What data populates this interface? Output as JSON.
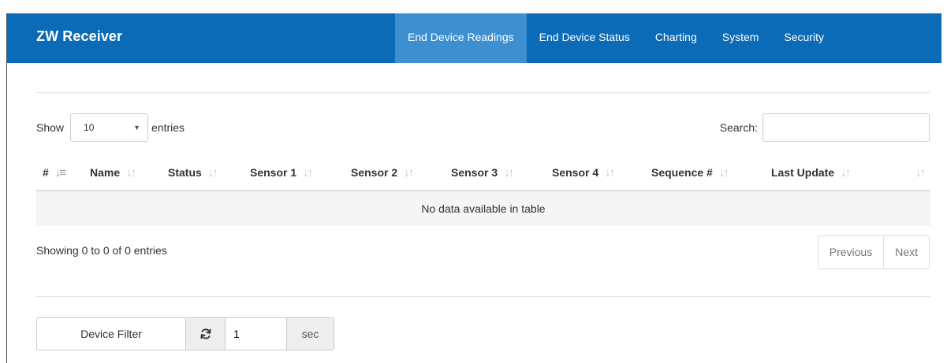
{
  "navbar": {
    "brand": "ZW Receiver",
    "items": [
      {
        "label": "End Device Readings",
        "active": true
      },
      {
        "label": "End Device Status"
      },
      {
        "label": "Charting"
      },
      {
        "label": "System"
      },
      {
        "label": "Security"
      }
    ]
  },
  "length_control": {
    "prefix": "Show",
    "value": "10",
    "suffix": "entries"
  },
  "search": {
    "label": "Search:",
    "value": ""
  },
  "table": {
    "columns": [
      "#",
      "Name",
      "Status",
      "Sensor 1",
      "Sensor 2",
      "Sensor 3",
      "Sensor 4",
      "Sequence #",
      "Last Update",
      ""
    ],
    "sorted_column": "#",
    "empty_message": "No data available in table",
    "rows": []
  },
  "info": "Showing 0 to 0 of 0 entries",
  "pagination": {
    "previous": "Previous",
    "next": "Next"
  },
  "controls": {
    "filter_label": "Device Filter",
    "refresh_icon": "refresh-icon",
    "interval_value": "1",
    "unit": "sec"
  },
  "colors": {
    "navbar": "#0c6bb6",
    "navbar_active": "#3d8fd0"
  }
}
